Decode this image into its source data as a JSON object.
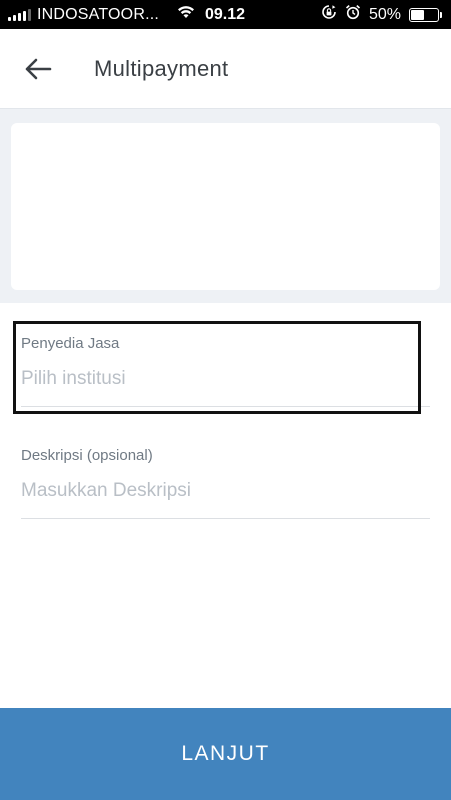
{
  "status_bar": {
    "carrier": "INDOSATOOR...",
    "time": "09.12",
    "battery_percent": "50%",
    "battery_level": 0.5,
    "icons": [
      "signal-icon",
      "wifi-icon",
      "rotation-lock-icon",
      "alarm-icon",
      "battery-icon"
    ]
  },
  "header": {
    "title": "Multipayment",
    "back_icon": "arrow-left-icon"
  },
  "form": {
    "provider": {
      "label": "Penyedia Jasa",
      "placeholder": "Pilih institusi",
      "value": ""
    },
    "description": {
      "label": "Deskripsi (opsional)",
      "placeholder": "Masukkan Deskripsi",
      "value": ""
    }
  },
  "actions": {
    "submit_label": "LANJUT"
  },
  "colors": {
    "primary": "#4284be",
    "card_background": "#eef1f5",
    "placeholder": "#b9bfc6",
    "label": "#707a84"
  }
}
